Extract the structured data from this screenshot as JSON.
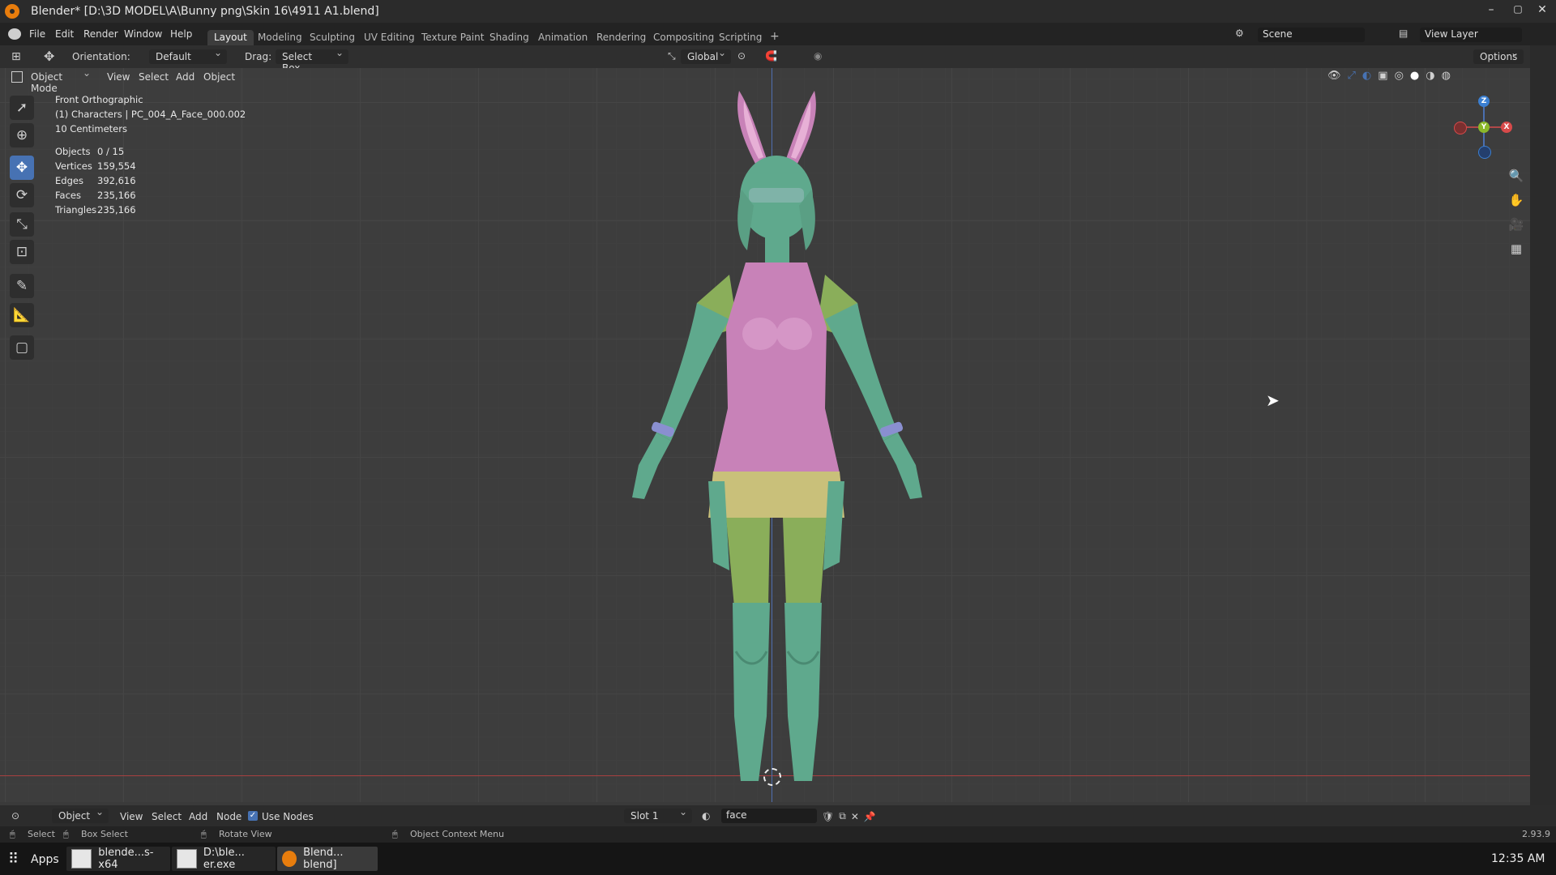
{
  "window": {
    "title": "Blender* [D:\\3D MODEL\\A\\Bunny png\\Skin 16\\4911 A1.blend]",
    "minimize": "–",
    "maximize": "▢",
    "close": "✕"
  },
  "menu": [
    "File",
    "Edit",
    "Render",
    "Window",
    "Help"
  ],
  "workspaces": [
    "Layout",
    "Modeling",
    "Sculpting",
    "UV Editing",
    "Texture Paint",
    "Shading",
    "Animation",
    "Rendering",
    "Compositing",
    "Scripting"
  ],
  "workspace_add": "+",
  "scene": {
    "value": "Scene"
  },
  "view_layer": {
    "value": "View Layer"
  },
  "toolbar": {
    "orientation_label": "Orientation:",
    "orientation_value": "Default",
    "drag_label": "Drag:",
    "drag_value": "Select Box",
    "transform_orientation": "Global",
    "options": "Options"
  },
  "viewport_header": {
    "mode": "Object Mode",
    "menus": [
      "View",
      "Select",
      "Add",
      "Object"
    ]
  },
  "viewport_info": {
    "view": "Front Orthographic",
    "collection": "(1) Characters | PC_004_A_Face_000.002",
    "scale": "10 Centimeters",
    "stats": [
      {
        "label": "Objects",
        "value": "0 / 15"
      },
      {
        "label": "Vertices",
        "value": "159,554"
      },
      {
        "label": "Edges",
        "value": "392,616"
      },
      {
        "label": "Faces",
        "value": "235,166"
      },
      {
        "label": "Triangles",
        "value": "235,166"
      }
    ]
  },
  "gizmo": {
    "x": "X",
    "y": "Y",
    "z": "Z"
  },
  "node_header": {
    "object": "Object",
    "menus": [
      "View",
      "Select",
      "Add",
      "Node"
    ],
    "use_nodes": "Use Nodes",
    "slot": "Slot 1",
    "material": "face"
  },
  "status": {
    "select": "Select",
    "box_select": "Box Select",
    "rotate_view": "Rotate View",
    "context_menu": "Object Context Menu",
    "version": "2.93.9"
  },
  "taskbar": {
    "apps": "Apps",
    "tasks": [
      "blende...s-x64",
      "D:\\ble... er.exe",
      "Blend... blend]"
    ],
    "time": "12:35 AM"
  },
  "colors": {
    "accent": "#4772b3",
    "body_green": "#5fa98d",
    "dress_pink": "#c882b8",
    "skirt_yellow": "#c9c07a",
    "limb_lime": "#8aae5a"
  }
}
